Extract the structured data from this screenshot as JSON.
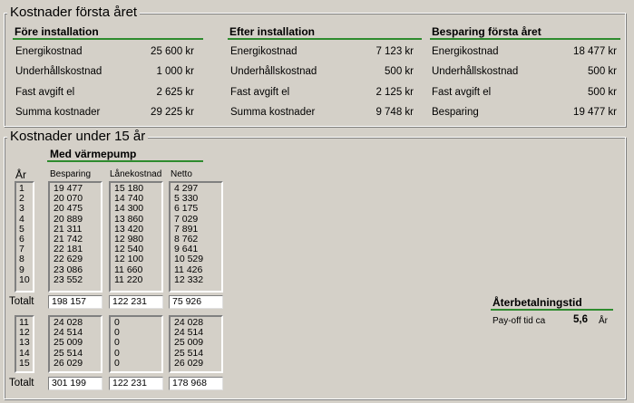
{
  "first_year": {
    "title": "Kostnader första året",
    "columns": [
      {
        "heading": "Före installation",
        "rows": [
          {
            "label": "Energikostnad",
            "value": "25 600 kr"
          },
          {
            "label": "Underhållskostnad",
            "value": "1 000 kr"
          },
          {
            "label": "Fast avgift el",
            "value": "2 625 kr"
          },
          {
            "label": "Summa kostnader",
            "value": "29 225 kr"
          }
        ]
      },
      {
        "heading": "Efter installation",
        "rows": [
          {
            "label": "Energikostnad",
            "value": "7 123 kr"
          },
          {
            "label": "Underhållskostnad",
            "value": "500 kr"
          },
          {
            "label": "Fast avgift el",
            "value": "2 125 kr"
          },
          {
            "label": "Summa kostnader",
            "value": "9 748 kr"
          }
        ]
      },
      {
        "heading": "Besparing första året",
        "rows": [
          {
            "label": "Energikostnad",
            "value": "18 477 kr"
          },
          {
            "label": "Underhållskostnad",
            "value": "500 kr"
          },
          {
            "label": "Fast avgift el",
            "value": "500 kr"
          },
          {
            "label": "Besparing",
            "value": "19 477 kr"
          }
        ]
      }
    ]
  },
  "fifteen_years": {
    "title": "Kostnader under 15 år",
    "subtitle": "Med värmepump",
    "headers": {
      "year": "År",
      "savings": "Besparing",
      "loan": "Lånekostnad",
      "net": "Netto"
    },
    "block1": {
      "years": [
        "1",
        "2",
        "3",
        "4",
        "5",
        "6",
        "7",
        "8",
        "9",
        "10"
      ],
      "savings": [
        "19 477",
        "20 070",
        "20 475",
        "20 889",
        "21 311",
        "21 742",
        "22 181",
        "22 629",
        "23 086",
        "23 552"
      ],
      "loan": [
        "15 180",
        "14 740",
        "14 300",
        "13 860",
        "13 420",
        "12 980",
        "12 540",
        "12 100",
        "11 660",
        "11 220"
      ],
      "net": [
        "4 297",
        "5 330",
        "6 175",
        "7 029",
        "7 891",
        "8 762",
        "9 641",
        "10 529",
        "11 426",
        "12 332"
      ],
      "total_label": "Totalt",
      "totals": {
        "savings": "198 157",
        "loan": "122 231",
        "net": "75 926"
      }
    },
    "block2": {
      "years": [
        "11",
        "12",
        "13",
        "14",
        "15"
      ],
      "savings": [
        "24 028",
        "24 514",
        "25 009",
        "25 514",
        "26 029"
      ],
      "loan": [
        "0",
        "0",
        "0",
        "0",
        "0"
      ],
      "net": [
        "24 028",
        "24 514",
        "25 009",
        "25 514",
        "26 029"
      ],
      "total_label": "Totalt",
      "totals": {
        "savings": "301 199",
        "loan": "122 231",
        "net": "178 968"
      }
    },
    "payback": {
      "heading": "Återbetalningstid",
      "label": "Pay-off tid ca",
      "value": "5,6",
      "unit": "År"
    }
  }
}
